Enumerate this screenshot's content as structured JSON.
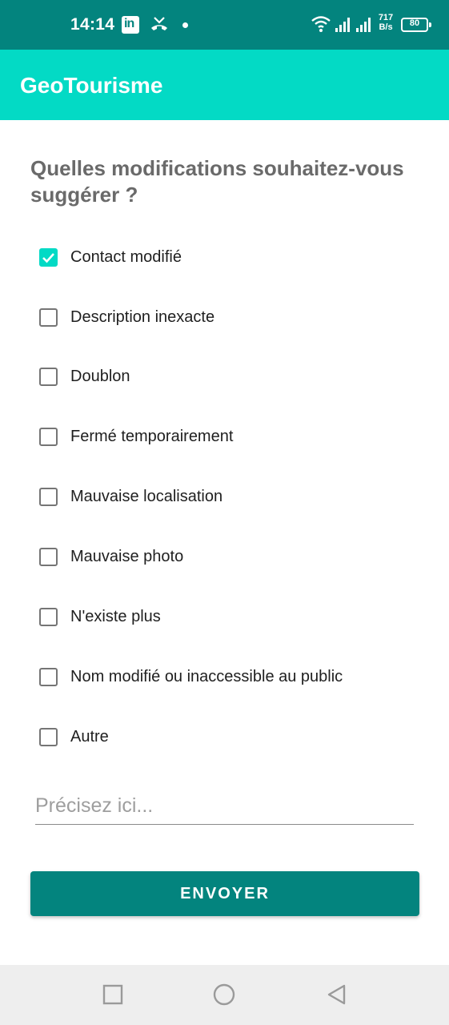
{
  "status_bar": {
    "time": "14:14",
    "network_speed_value": "717",
    "network_speed_unit": "B/s",
    "battery": "80",
    "icons": [
      "linkedin-icon",
      "missed-call-icon",
      "notification-dot-icon",
      "wifi-icon",
      "signal-icon",
      "signal-icon",
      "battery-icon"
    ]
  },
  "app_bar": {
    "title": "GeoTourisme"
  },
  "form": {
    "question": "Quelles modifications souhaitez-vous suggérer ?",
    "options": [
      {
        "label": "Contact modifié",
        "checked": true
      },
      {
        "label": "Description inexacte",
        "checked": false
      },
      {
        "label": "Doublon",
        "checked": false
      },
      {
        "label": "Fermé temporairement",
        "checked": false
      },
      {
        "label": "Mauvaise localisation",
        "checked": false
      },
      {
        "label": "Mauvaise photo",
        "checked": false
      },
      {
        "label": "N'existe plus",
        "checked": false
      },
      {
        "label": "Nom modifié ou inaccessible au public",
        "checked": false
      },
      {
        "label": "Autre",
        "checked": false
      }
    ],
    "details_placeholder": "Précisez ici...",
    "details_value": "",
    "submit_label": "ENVOYER"
  },
  "colors": {
    "status_bar": "#03847e",
    "app_bar": "#03dac5",
    "accent": "#03dac5",
    "button": "#03847e",
    "nav_bar": "#eeeeee"
  },
  "nav_bar": {
    "buttons": [
      "recents-icon",
      "home-icon",
      "back-icon"
    ]
  }
}
